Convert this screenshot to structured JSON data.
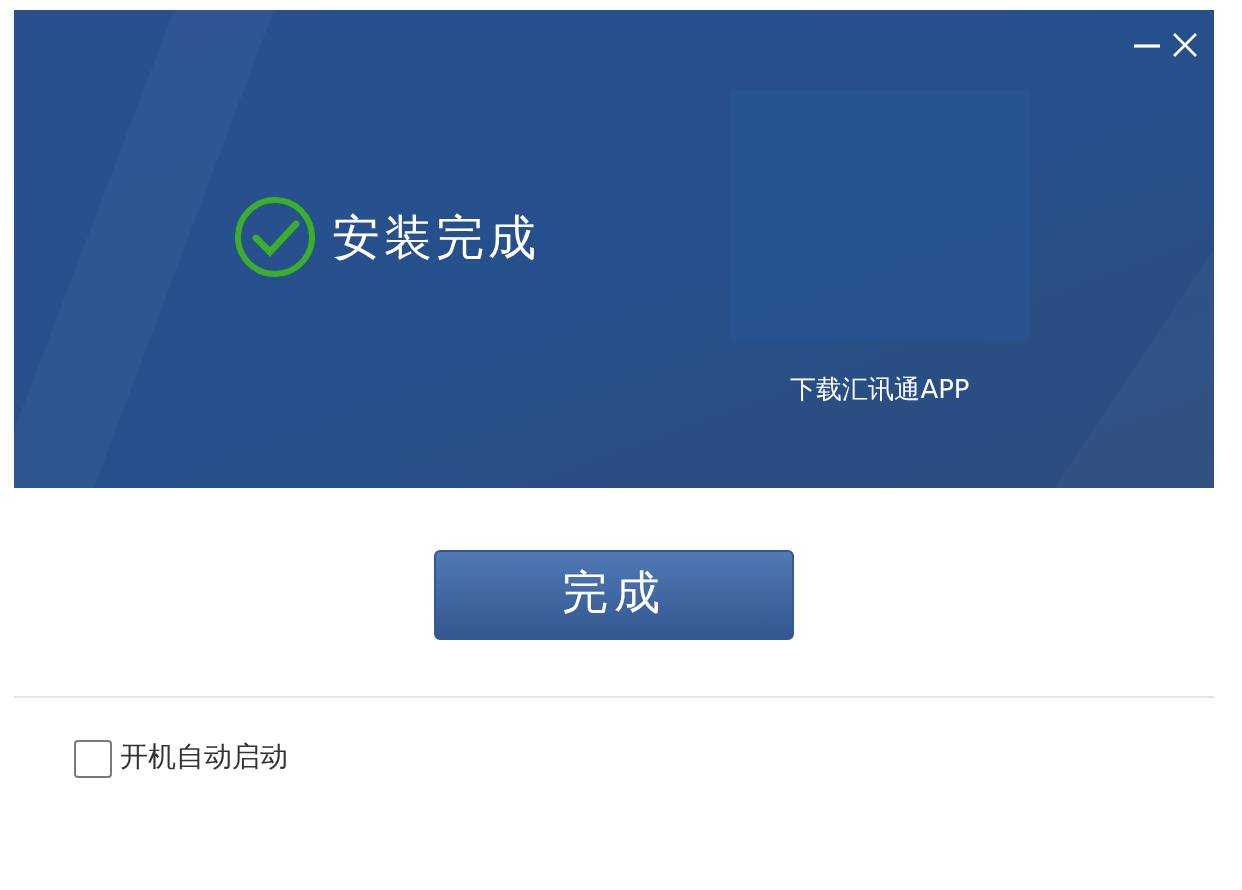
{
  "window": {
    "minimizable": true,
    "closable": true
  },
  "banner": {
    "title": "安装完成",
    "qr_caption": "下载汇讯通APP"
  },
  "finish_button": {
    "label": "完成"
  },
  "autostart": {
    "label": "开机自动启动",
    "checked": false
  }
}
